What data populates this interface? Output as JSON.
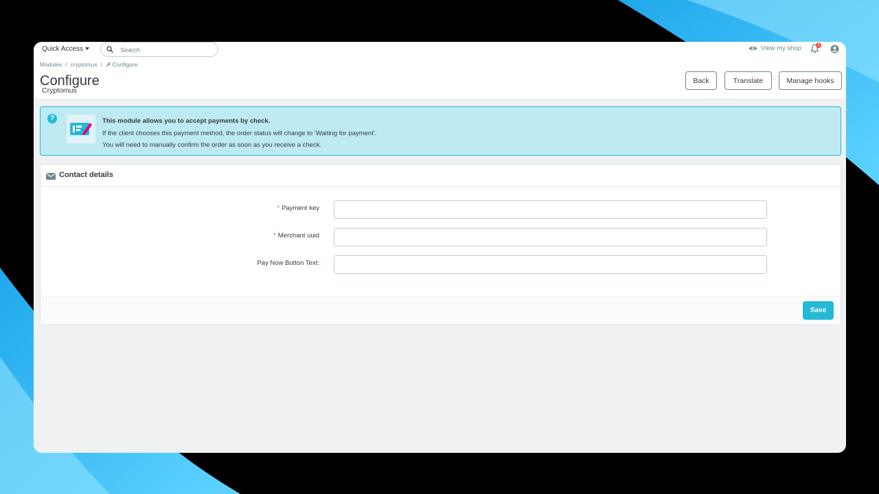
{
  "header": {
    "quick_access_label": "Quick Access",
    "search_placeholder": "Search",
    "view_shop_label": "View my shop",
    "notification_count": "2"
  },
  "breadcrumb": {
    "items": [
      "Modules",
      "cryptomus",
      "Configure"
    ]
  },
  "page": {
    "title": "Configure",
    "subtitle": "Cryptomus"
  },
  "toolbar": {
    "back_label": "Back",
    "translate_label": "Translate",
    "manage_hooks_label": "Manage hooks"
  },
  "info": {
    "heading": "This module allows you to accept payments by check.",
    "line1": "If the client chooses this payment method, the order status will change to 'Waiting for payment'.",
    "line2": "You will need to manually confirm the order as soon as you receive a check."
  },
  "panel": {
    "title": "Contact details",
    "fields": [
      {
        "label": "Payment key",
        "required": true,
        "value": ""
      },
      {
        "label": "Merchant uuid",
        "required": true,
        "value": ""
      },
      {
        "label": "Pay Now Button Text:",
        "required": false,
        "value": ""
      }
    ],
    "required_mark": "*",
    "save_label": "Save"
  },
  "colors": {
    "accent": "#25b9d7",
    "info_bg": "#bdeaf3",
    "text": "#363a41"
  }
}
